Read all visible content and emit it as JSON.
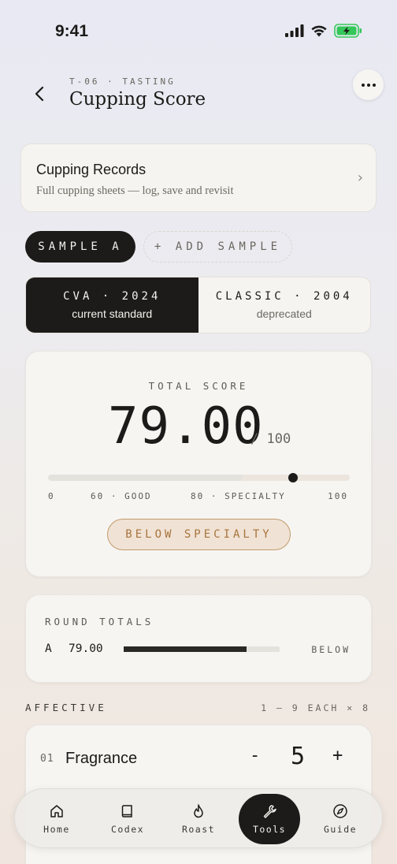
{
  "status_bar": {
    "time": "9:41"
  },
  "header": {
    "back_icon": "chevron-left-icon",
    "kicker": "T-06 · TASTING",
    "title": "Cupping Score",
    "more_icon": "ellipsis-icon"
  },
  "records": {
    "title": "Cupping Records",
    "subtitle": "Full cupping sheets — log, save and revisit",
    "chevron": "›"
  },
  "samples": {
    "active": "SAMPLE A",
    "add": "+ ADD SAMPLE"
  },
  "standards": [
    {
      "name": "CVA · 2024",
      "note": "current standard",
      "selected": true
    },
    {
      "name": "CLASSIC · 2004",
      "note": "deprecated",
      "selected": false
    }
  ],
  "total": {
    "label": "TOTAL SCORE",
    "score": "79.00",
    "out_of": "/ 100",
    "value": 79,
    "range": [
      0,
      100
    ],
    "ticks": [
      {
        "label": "0",
        "at": 0
      },
      {
        "label": "60 · GOOD",
        "at": 60
      },
      {
        "label": "80 · SPECIALTY",
        "at": 80
      },
      {
        "label": "100",
        "at": 100
      }
    ],
    "badge": "BELOW SPECIALTY",
    "badge_color": "#a8743d"
  },
  "round_totals": {
    "label": "ROUND TOTALS",
    "rows": [
      {
        "sample": "A",
        "score": "79.00",
        "fraction": 0.79,
        "status": "BELOW"
      }
    ]
  },
  "affective": {
    "label": "AFFECTIVE",
    "scale": "1 – 9 EACH × 8",
    "items": [
      {
        "index": "01",
        "name": "Fragrance",
        "minus": "-",
        "value": "5",
        "plus": "+"
      }
    ]
  },
  "tabbar": [
    {
      "label": "Home",
      "icon": "home-icon",
      "active": false
    },
    {
      "label": "Codex",
      "icon": "book-icon",
      "active": false
    },
    {
      "label": "Roast",
      "icon": "flame-icon",
      "active": false
    },
    {
      "label": "Tools",
      "icon": "wrench-icon",
      "active": true
    },
    {
      "label": "Guide",
      "icon": "compass-icon",
      "active": false
    }
  ]
}
